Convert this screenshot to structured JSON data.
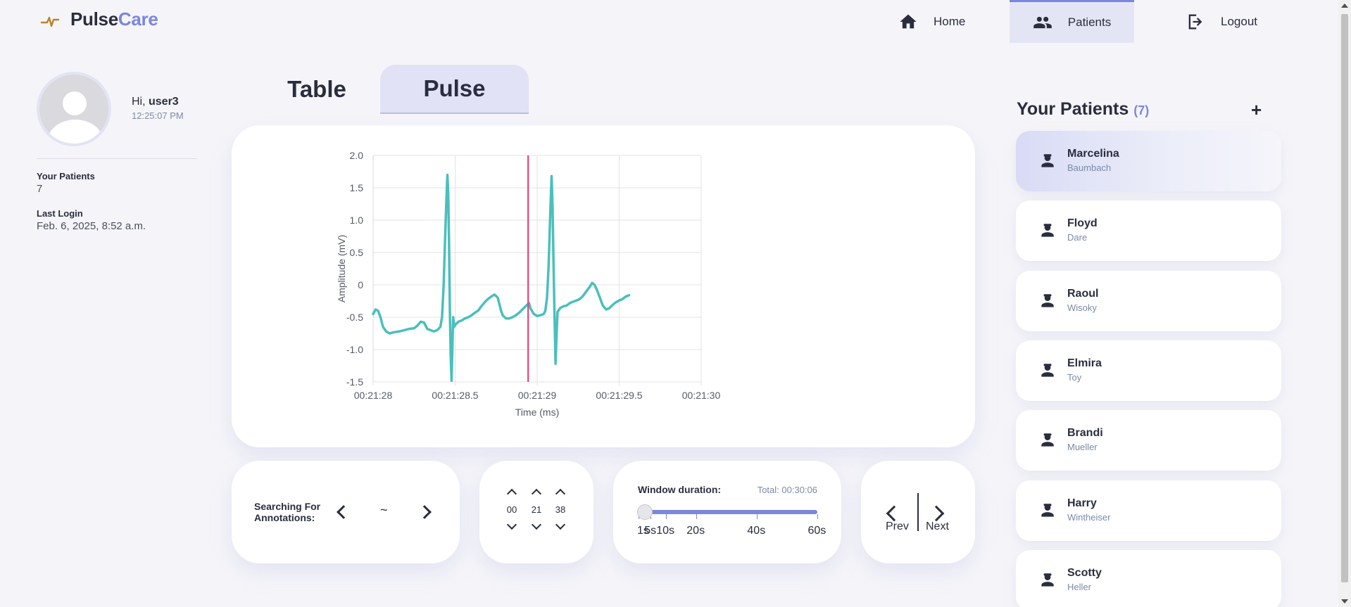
{
  "brand": {
    "part1": "Pulse",
    "part2": "Care"
  },
  "nav": [
    {
      "label": "Home",
      "icon": "home-icon"
    },
    {
      "label": "Patients",
      "icon": "people-icon"
    },
    {
      "label": "Logout",
      "icon": "logout-icon"
    }
  ],
  "profile": {
    "greeting": "Hi, ",
    "username": "user3",
    "time": "12:25:07 PM",
    "stats": [
      {
        "label": "Your Patients",
        "value": "7"
      },
      {
        "label": "Last Login",
        "value": "Feb. 6, 2025, 8:52 a.m."
      }
    ]
  },
  "tabs": [
    {
      "label": "Table",
      "active": false
    },
    {
      "label": "Pulse",
      "active": true
    }
  ],
  "chart_data": {
    "type": "line",
    "title": "",
    "xlabel": "Time (ms)",
    "ylabel": "Amplitude (mV)",
    "xlim": [
      0,
      2000
    ],
    "ylim": [
      -1.5,
      2.0
    ],
    "x_ticks": [
      {
        "value": 0,
        "label": "00:21:28"
      },
      {
        "value": 500,
        "label": "00:21:28.5"
      },
      {
        "value": 1000,
        "label": "00:21:29"
      },
      {
        "value": 1500,
        "label": "00:21:29.5"
      },
      {
        "value": 2000,
        "label": "00:21:30"
      }
    ],
    "y_ticks": [
      {
        "value": 2.0,
        "label": "2.0"
      },
      {
        "value": 1.5,
        "label": "1.5"
      },
      {
        "value": 1.0,
        "label": "1.0"
      },
      {
        "value": 0.5,
        "label": "0.5"
      },
      {
        "value": 0,
        "label": "0"
      },
      {
        "value": -0.5,
        "label": "-0.5"
      },
      {
        "value": -1.0,
        "label": "-1.0"
      },
      {
        "value": -1.5,
        "label": "-1.5"
      }
    ],
    "grid": true,
    "series": [
      {
        "color": "#4bbfbb",
        "points": [
          [
            0,
            -0.45
          ],
          [
            15,
            -0.38
          ],
          [
            30,
            -0.4
          ],
          [
            45,
            -0.5
          ],
          [
            60,
            -0.65
          ],
          [
            80,
            -0.72
          ],
          [
            100,
            -0.75
          ],
          [
            130,
            -0.73
          ],
          [
            160,
            -0.72
          ],
          [
            190,
            -0.7
          ],
          [
            220,
            -0.68
          ],
          [
            250,
            -0.67
          ],
          [
            270,
            -0.63
          ],
          [
            290,
            -0.57
          ],
          [
            310,
            -0.58
          ],
          [
            330,
            -0.68
          ],
          [
            350,
            -0.7
          ],
          [
            370,
            -0.72
          ],
          [
            390,
            -0.7
          ],
          [
            410,
            -0.65
          ],
          [
            420,
            -0.5
          ],
          [
            430,
            0.0
          ],
          [
            440,
            0.8
          ],
          [
            447,
            1.35
          ],
          [
            453,
            1.7
          ],
          [
            458,
            1.4
          ],
          [
            463,
            0.6
          ],
          [
            468,
            -0.4
          ],
          [
            473,
            -1.1
          ],
          [
            478,
            -1.48
          ],
          [
            483,
            -1.0
          ],
          [
            488,
            -0.5
          ],
          [
            494,
            -0.65
          ],
          [
            500,
            -0.62
          ],
          [
            520,
            -0.57
          ],
          [
            540,
            -0.55
          ],
          [
            560,
            -0.52
          ],
          [
            580,
            -0.5
          ],
          [
            600,
            -0.47
          ],
          [
            620,
            -0.43
          ],
          [
            640,
            -0.4
          ],
          [
            660,
            -0.33
          ],
          [
            680,
            -0.27
          ],
          [
            700,
            -0.22
          ],
          [
            720,
            -0.18
          ],
          [
            740,
            -0.15
          ],
          [
            760,
            -0.2
          ],
          [
            770,
            -0.3
          ],
          [
            780,
            -0.4
          ],
          [
            790,
            -0.47
          ],
          [
            810,
            -0.52
          ],
          [
            830,
            -0.52
          ],
          [
            850,
            -0.5
          ],
          [
            870,
            -0.47
          ],
          [
            890,
            -0.43
          ],
          [
            910,
            -0.38
          ],
          [
            930,
            -0.33
          ],
          [
            950,
            -0.28
          ],
          [
            960,
            -0.37
          ],
          [
            980,
            -0.45
          ],
          [
            1000,
            -0.48
          ],
          [
            1020,
            -0.47
          ],
          [
            1040,
            -0.45
          ],
          [
            1050,
            -0.4
          ],
          [
            1060,
            -0.2
          ],
          [
            1070,
            0.3
          ],
          [
            1080,
            1.1
          ],
          [
            1088,
            1.68
          ],
          [
            1094,
            1.2
          ],
          [
            1100,
            0.3
          ],
          [
            1106,
            -0.5
          ],
          [
            1112,
            -1.22
          ],
          [
            1118,
            -0.8
          ],
          [
            1124,
            -0.42
          ],
          [
            1140,
            -0.36
          ],
          [
            1160,
            -0.33
          ],
          [
            1180,
            -0.32
          ],
          [
            1200,
            -0.28
          ],
          [
            1220,
            -0.26
          ],
          [
            1240,
            -0.24
          ],
          [
            1260,
            -0.22
          ],
          [
            1280,
            -0.17
          ],
          [
            1300,
            -0.1
          ],
          [
            1320,
            -0.03
          ],
          [
            1335,
            0.03
          ],
          [
            1350,
            0.0
          ],
          [
            1365,
            -0.08
          ],
          [
            1380,
            -0.18
          ],
          [
            1400,
            -0.32
          ],
          [
            1420,
            -0.38
          ],
          [
            1440,
            -0.36
          ],
          [
            1460,
            -0.31
          ],
          [
            1480,
            -0.27
          ],
          [
            1500,
            -0.24
          ],
          [
            1520,
            -0.22
          ],
          [
            1540,
            -0.18
          ],
          [
            1560,
            -0.16
          ]
        ]
      }
    ],
    "marker": {
      "x": 945,
      "color": "#e0457b"
    }
  },
  "annotations": {
    "label": "Searching For Annotations:",
    "value": "~"
  },
  "time_picker": {
    "values": [
      "00",
      "21",
      "38"
    ]
  },
  "window": {
    "label": "Window duration:",
    "total": "Total: 00:30:06",
    "value_s": 1,
    "options": [
      {
        "label": "1s",
        "value": 1
      },
      {
        "label": "5s",
        "value": 5
      },
      {
        "label": "10s",
        "value": 10
      },
      {
        "label": "20s",
        "value": 20
      },
      {
        "label": "40s",
        "value": 40
      },
      {
        "label": "60s",
        "value": 60
      }
    ]
  },
  "pager": {
    "prev": "Prev",
    "next": "Next"
  },
  "patients": {
    "title": "Your Patients",
    "count": "(7)",
    "add": "+",
    "list": [
      {
        "first": "Marcelina",
        "last": "Baumbach",
        "active": true
      },
      {
        "first": "Floyd",
        "last": "Dare",
        "active": false
      },
      {
        "first": "Raoul",
        "last": "Wisoky",
        "active": false
      },
      {
        "first": "Elmira",
        "last": "Toy",
        "active": false
      },
      {
        "first": "Brandi",
        "last": "Mueller",
        "active": false
      },
      {
        "first": "Harry",
        "last": "Wintheiser",
        "active": false
      },
      {
        "first": "Scotty",
        "last": "Heller",
        "active": false
      }
    ]
  }
}
